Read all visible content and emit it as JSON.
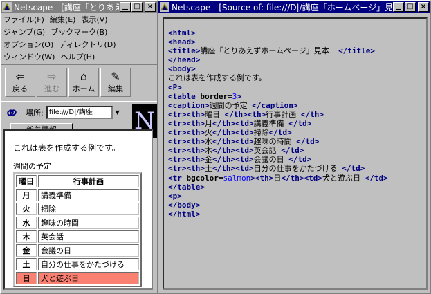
{
  "left_window": {
    "title": "Netscape - [講座「とりあえずホ",
    "menu": [
      "ファイル(F)",
      "編集(E)",
      "表示(V)",
      "ジャンプ(G)",
      "ブックマーク(B)",
      "オプション(O)",
      "ディレクトリ(D)",
      "ウィンドウ(W)",
      "ヘルプ(H)"
    ],
    "toolbar": {
      "back": "戻る",
      "forward": "進む",
      "home": "ホーム",
      "edit": "編集"
    },
    "location_label": "場所:",
    "location_value": "file:///D|/講座",
    "whats_new": "新着情報",
    "throbber_letter": "N",
    "content": {
      "paragraph": "これは表を作成する例です。",
      "caption": "週間の予定",
      "headers": [
        "曜日",
        "行事計画"
      ],
      "rows": [
        {
          "day": "月",
          "event": "講義準備"
        },
        {
          "day": "火",
          "event": "掃除"
        },
        {
          "day": "水",
          "event": "趣味の時間"
        },
        {
          "day": "木",
          "event": "英会話"
        },
        {
          "day": "金",
          "event": "会議の日"
        },
        {
          "day": "土",
          "event": "自分の仕事をかたづける"
        },
        {
          "day": "日",
          "event": "犬と遊ぶ日"
        }
      ],
      "highlight_color": "#fa8072"
    }
  },
  "right_window": {
    "title": "Netscape - [Source of: file:///D|/講座「ホームページ」見本/...",
    "source_lines": [
      [
        [
          "t",
          "<html>"
        ]
      ],
      [
        [
          "t",
          "<head>"
        ]
      ],
      [
        [
          "t",
          "<title>"
        ],
        [
          "x",
          "講座「とりあえずホームページ」見本  "
        ],
        [
          "t",
          "</title>"
        ]
      ],
      [
        [
          "t",
          "</head>"
        ]
      ],
      [
        [
          "t",
          "<body>"
        ]
      ],
      [
        [
          "x",
          "これは表を作成する例です。"
        ]
      ],
      [
        [
          "t",
          "<P>"
        ]
      ],
      [
        [
          "t",
          "<table "
        ],
        [
          "a",
          "border"
        ],
        [
          "x",
          "="
        ],
        [
          "v",
          "3"
        ],
        [
          "t",
          ">"
        ]
      ],
      [
        [
          "t",
          "<caption>"
        ],
        [
          "x",
          "週間の予定 "
        ],
        [
          "t",
          "</caption>"
        ]
      ],
      [
        [
          "t",
          "<tr><th>"
        ],
        [
          "x",
          "曜日 "
        ],
        [
          "t",
          "</th><th>"
        ],
        [
          "x",
          "行事計画 "
        ],
        [
          "t",
          "</th>"
        ]
      ],
      [
        [
          "t",
          "<tr><th>"
        ],
        [
          "x",
          "月"
        ],
        [
          "t",
          "</th><td>"
        ],
        [
          "x",
          "講義準備 "
        ],
        [
          "t",
          "</td>"
        ]
      ],
      [
        [
          "t",
          "<tr><th>"
        ],
        [
          "x",
          "火"
        ],
        [
          "t",
          "</th><td>"
        ],
        [
          "x",
          "掃除"
        ],
        [
          "t",
          "</td>"
        ]
      ],
      [
        [
          "t",
          "<tr><th>"
        ],
        [
          "x",
          "水"
        ],
        [
          "t",
          "</th><td>"
        ],
        [
          "x",
          "趣味の時間 "
        ],
        [
          "t",
          "</td>"
        ]
      ],
      [
        [
          "t",
          "<tr><th>"
        ],
        [
          "x",
          "木"
        ],
        [
          "t",
          "</th><td>"
        ],
        [
          "x",
          "英会話 "
        ],
        [
          "t",
          "</td>"
        ]
      ],
      [
        [
          "t",
          "<tr><th>"
        ],
        [
          "x",
          "金"
        ],
        [
          "t",
          "</th><td>"
        ],
        [
          "x",
          "会議の日 "
        ],
        [
          "t",
          "</td>"
        ]
      ],
      [
        [
          "t",
          "<tr><th>"
        ],
        [
          "x",
          "土"
        ],
        [
          "t",
          "</th><td>"
        ],
        [
          "x",
          "自分の仕事をかたづける "
        ],
        [
          "t",
          "</td>"
        ]
      ],
      [
        [
          "t",
          "<tr "
        ],
        [
          "a",
          "bgcolor"
        ],
        [
          "x",
          "="
        ],
        [
          "v",
          "salmon"
        ],
        [
          "t",
          "><th>"
        ],
        [
          "x",
          "日"
        ],
        [
          "t",
          "</th><td>"
        ],
        [
          "x",
          "犬と遊ぶ日 "
        ],
        [
          "t",
          "</td>"
        ]
      ],
      [
        [
          "t",
          "</table>"
        ]
      ],
      [
        [
          "t",
          "<p>"
        ]
      ],
      [
        [
          "t",
          "</body>"
        ]
      ],
      [
        [
          "t",
          "</html>"
        ]
      ]
    ]
  },
  "colors": {
    "titlebar_active": "#000080",
    "titlebar_inactive": "#808080",
    "source_tag": "#000080",
    "source_value": "#0000ff"
  }
}
